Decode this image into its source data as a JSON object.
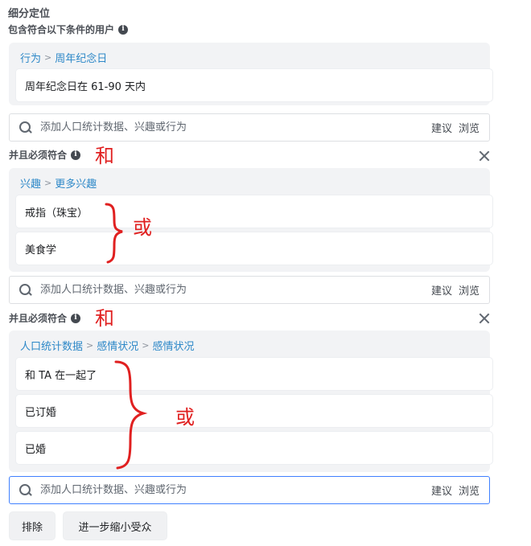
{
  "header": {
    "title": "细分定位",
    "subtitle": "包含符合以下条件的用户"
  },
  "groups": [
    {
      "breadcrumb": [
        "行为",
        "周年纪念日"
      ],
      "items": [
        "周年纪念日在 61-90 天内"
      ]
    },
    {
      "breadcrumb": [
        "兴趣",
        "更多兴趣"
      ],
      "items": [
        "戒指（珠宝）",
        "美食学"
      ]
    },
    {
      "breadcrumb": [
        "人口统计数据",
        "感情状况",
        "感情状况"
      ],
      "items": [
        "和 TA 在一起了",
        "已订婚",
        "已婚"
      ]
    }
  ],
  "search": {
    "placeholder": "添加人口统计数据、兴趣或行为",
    "suggest_label": "建议",
    "browse_label": "浏览"
  },
  "and_label": "并且必须符合",
  "annotations": {
    "and_note": "和",
    "or_note": "或",
    "color": "#e02020"
  },
  "buttons": {
    "exclude": "排除",
    "narrow": "进一步缩小受众"
  },
  "icons": {
    "info": "info-icon",
    "search": "search-icon",
    "close": "close-icon"
  },
  "colors": {
    "link": "#2d88c8",
    "group_bg": "#f2f3f5",
    "active_border": "#4080ff"
  }
}
